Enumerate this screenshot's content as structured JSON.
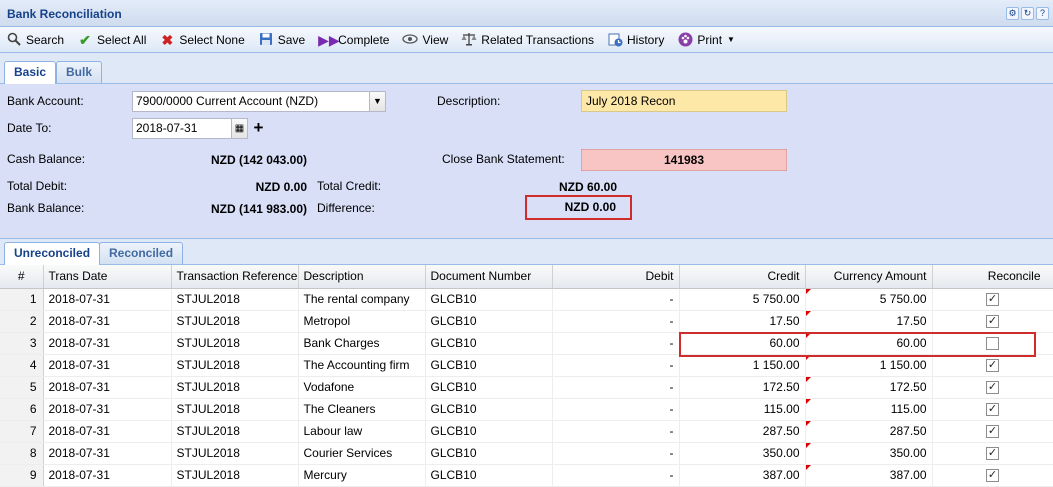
{
  "window": {
    "title": "Bank Reconciliation",
    "title_icons": [
      "gear-icon",
      "refresh-icon",
      "help-icon"
    ]
  },
  "toolbar": {
    "search": "Search",
    "select_all": "Select All",
    "select_none": "Select None",
    "save": "Save",
    "complete": "Complete",
    "view": "View",
    "related": "Related Transactions",
    "history": "History",
    "print": "Print"
  },
  "main_tabs": [
    "Basic",
    "Bulk"
  ],
  "form": {
    "bank_account_label": "Bank Account:",
    "bank_account_value": "7900/0000 Current Account (NZD)",
    "date_to_label": "Date To:",
    "date_to_value": "2018-07-31",
    "description_label": "Description:",
    "description_value": "July 2018 Recon",
    "cash_balance_label": "Cash Balance:",
    "cash_balance_value": "NZD (142 043.00)",
    "close_bank_label": "Close Bank Statement:",
    "close_bank_value": "141983",
    "total_debit_label": "Total Debit:",
    "total_debit_value": "NZD 0.00",
    "total_credit_label": "Total Credit:",
    "total_credit_value": "NZD 60.00",
    "bank_balance_label": "Bank Balance:",
    "bank_balance_value": "NZD (141 983.00)",
    "difference_label": "Difference:",
    "difference_value": "NZD 0.00"
  },
  "sub_tabs": [
    "Unreconciled",
    "Reconciled"
  ],
  "grid": {
    "columns": [
      "#",
      "Trans Date",
      "Transaction Reference",
      "Description",
      "Document Number",
      "Debit",
      "Credit",
      "Currency Amount",
      "Reconcile"
    ],
    "rows": [
      {
        "n": "1",
        "date": "2018-07-31",
        "ref": "STJUL2018",
        "desc": "The rental company",
        "doc": "GLCB10",
        "debit": "-",
        "credit": "5 750.00",
        "amount": "5 750.00",
        "reconciled": true
      },
      {
        "n": "2",
        "date": "2018-07-31",
        "ref": "STJUL2018",
        "desc": "Metropol",
        "doc": "GLCB10",
        "debit": "-",
        "credit": "17.50",
        "amount": "17.50",
        "reconciled": true
      },
      {
        "n": "3",
        "date": "2018-07-31",
        "ref": "STJUL2018",
        "desc": "Bank Charges",
        "doc": "GLCB10",
        "debit": "-",
        "credit": "60.00",
        "amount": "60.00",
        "reconciled": false
      },
      {
        "n": "4",
        "date": "2018-07-31",
        "ref": "STJUL2018",
        "desc": "The Accounting firm",
        "doc": "GLCB10",
        "debit": "-",
        "credit": "1 150.00",
        "amount": "1 150.00",
        "reconciled": true
      },
      {
        "n": "5",
        "date": "2018-07-31",
        "ref": "STJUL2018",
        "desc": "Vodafone",
        "doc": "GLCB10",
        "debit": "-",
        "credit": "172.50",
        "amount": "172.50",
        "reconciled": true
      },
      {
        "n": "6",
        "date": "2018-07-31",
        "ref": "STJUL2018",
        "desc": "The Cleaners",
        "doc": "GLCB10",
        "debit": "-",
        "credit": "115.00",
        "amount": "115.00",
        "reconciled": true
      },
      {
        "n": "7",
        "date": "2018-07-31",
        "ref": "STJUL2018",
        "desc": "Labour law",
        "doc": "GLCB10",
        "debit": "-",
        "credit": "287.50",
        "amount": "287.50",
        "reconciled": true
      },
      {
        "n": "8",
        "date": "2018-07-31",
        "ref": "STJUL2018",
        "desc": "Courier Services",
        "doc": "GLCB10",
        "debit": "-",
        "credit": "350.00",
        "amount": "350.00",
        "reconciled": true
      },
      {
        "n": "9",
        "date": "2018-07-31",
        "ref": "STJUL2018",
        "desc": "Mercury",
        "doc": "GLCB10",
        "debit": "-",
        "credit": "387.00",
        "amount": "387.00",
        "reconciled": true
      }
    ]
  },
  "colors": {
    "panel_bg": "#d8dff7",
    "description_bg": "#fde8a8",
    "close_bank_bg": "#f9c4c4",
    "highlight_border": "#d12c2c",
    "title_text": "#15428b"
  }
}
